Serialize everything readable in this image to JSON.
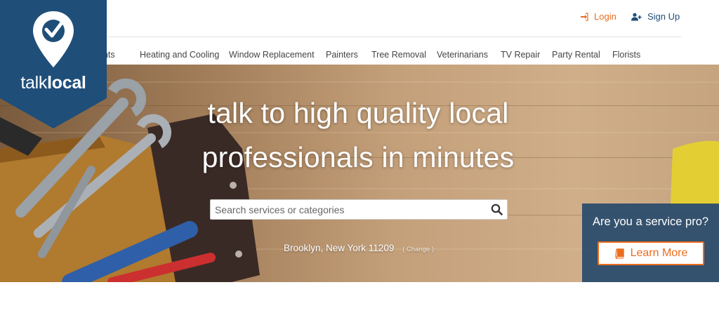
{
  "header": {
    "login_label": "Login",
    "signup_label": "Sign Up"
  },
  "logo": {
    "text_light": "talk",
    "text_bold": "local"
  },
  "nav": {
    "items": [
      "ants",
      "Heating and Cooling",
      "Window Replacement",
      "Painters",
      "Tree Removal",
      "Veterinarians",
      "TV Repair",
      "Party Rental",
      "Florists"
    ]
  },
  "hero": {
    "headline_line1": "talk to high quality local",
    "headline_line2": "professionals in minutes",
    "search_placeholder": "Search services or categories",
    "location": "Brooklyn, New York 11209",
    "change_label": "( Change )"
  },
  "pro": {
    "question": "Are you a service pro?",
    "learn_more_label": "Learn More"
  },
  "icons": {
    "login": "sign-in-icon",
    "signup": "user-plus-icon",
    "search": "search-icon",
    "learn_more": "book-icon",
    "logo": "location-check-icon"
  },
  "colors": {
    "brand_blue": "#1f4e79",
    "accent_orange": "#ea6d1e",
    "panel_blue": "#274a6b"
  }
}
